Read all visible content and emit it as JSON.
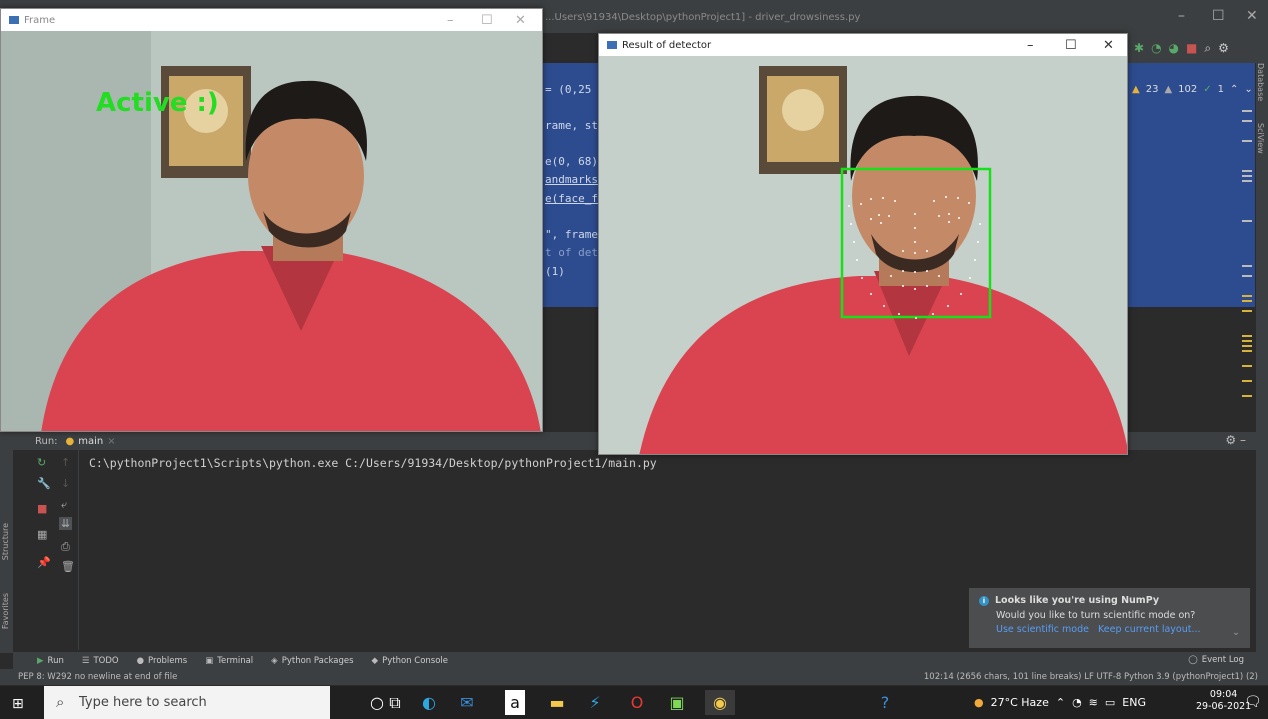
{
  "ide": {
    "title": "...Users\\91934\\Desktop\\pythonProject1] - driver_drowsiness.py",
    "editor_lines": [
      "= (0,25",
      "rame, st",
      "e(0, 68)",
      "andmarks",
      "e(face_f",
      "\", frame",
      "t of dete",
      "(1)"
    ],
    "inspection": {
      "warn1": "23",
      "warn2": "102",
      "ok": "1"
    },
    "right_tabs": [
      "Database",
      "SciView"
    ],
    "left_tabs": [
      "Structure",
      "Favorites"
    ]
  },
  "frame_window": {
    "title": "Frame",
    "overlay_text": "Active :)"
  },
  "result_window": {
    "title": "Result of detector"
  },
  "run_panel": {
    "label": "Run:",
    "tab": "main",
    "command": "C:\\pythonProject1\\Scripts\\python.exe C:/Users/91934/Desktop/pythonProject1/main.py"
  },
  "notification": {
    "title": "Looks like you're using NumPy",
    "body": "Would you like to turn scientific mode on?",
    "action1": "Use scientific mode",
    "action2": "Keep current layout..."
  },
  "tool_tabs": [
    "Run",
    "TODO",
    "Problems",
    "Terminal",
    "Python Packages",
    "Python Console"
  ],
  "event_log": "Event Log",
  "status": {
    "left": "PEP 8: W292 no newline at end of file",
    "right": "102:14 (2656 chars, 101 line breaks)  LF  UTF-8  Python 3.9 (pythonProject1) (2)"
  },
  "taskbar": {
    "search_placeholder": "Type here to search",
    "weather": "27°C  Haze",
    "lang": "ENG",
    "time": "09:04",
    "date": "29-06-2021"
  },
  "colors": {
    "overlay_green": "#22dd22",
    "box_green": "#18e018",
    "editor_selection": "#2d4c8f"
  }
}
